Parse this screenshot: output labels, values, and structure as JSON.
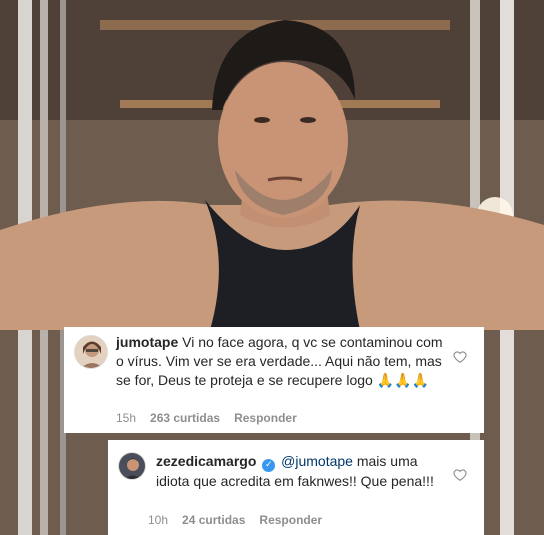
{
  "comments": [
    {
      "username": "jumotape",
      "text": "Vi no face agora, q vc se contaminou com o vírus. Vim ver se era verdade... Aqui não tem, mas se for, Deus te proteja e se recupere logo",
      "emoji": "🙏🙏🙏",
      "time": "15h",
      "likes": "263 curtidas",
      "reply": "Responder"
    },
    {
      "username": "zezedicamargo",
      "verified": "✓",
      "mention": "@jumotape",
      "text": " mais uma idiota que acredita em faknwes!! Que pena!!!",
      "time": "10h",
      "likes": "24 curtidas",
      "reply": "Responder"
    }
  ],
  "icons": {
    "heart": "heart-icon",
    "verified": "verified-badge-icon"
  },
  "colors": {
    "text": "#262626",
    "meta": "#8e8e8e",
    "mention": "#00376b",
    "verified": "#3897f0"
  }
}
